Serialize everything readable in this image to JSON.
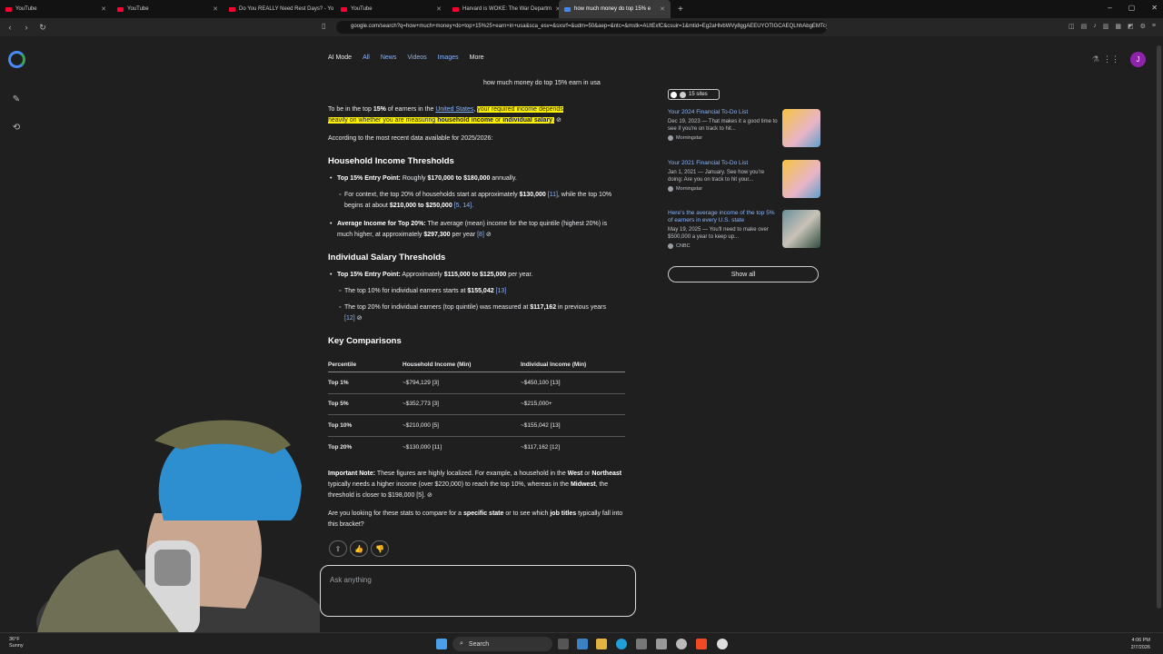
{
  "browser": {
    "tabs": [
      {
        "label": "YouTube",
        "active": false
      },
      {
        "label": "YouTube",
        "active": false
      },
      {
        "label": "Do You REALLY Need Rest Days? - Yo",
        "active": false
      },
      {
        "label": "YouTube",
        "active": false
      },
      {
        "label": "Harvard is WOKE: The War Departm",
        "active": false
      },
      {
        "label": "how much money do top 15% e",
        "active": true
      }
    ],
    "new_tab": "+",
    "url": "google.com/search?q=how+much+money+do+top+15%25+earn+in+usa&sca_esv=&sxsrf=&udm=50&aep=&ntc=&mstk=AUtExfC&csuir=1&mtid=Eg2aHlvbWVy8ggAEEUYOTIGCAEQLhhAbgEMTcyNzkgMGoxqg",
    "window_controls": [
      "–",
      "▢",
      "✕"
    ]
  },
  "search_tabs": [
    {
      "label": "AI Mode",
      "active": true
    },
    {
      "label": "All"
    },
    {
      "label": "News"
    },
    {
      "label": "Images"
    },
    {
      "label": "Videos"
    },
    {
      "label": "Images"
    },
    {
      "label": "More"
    }
  ],
  "search_tabs_display": [
    "AI Mode",
    "All",
    "News",
    "Videos",
    "Images",
    "More"
  ],
  "avatar_letter": "J",
  "query": "how much money do top 15% earn in usa",
  "answer": {
    "intro_pre": "To be in the top ",
    "intro_pct": "15%",
    "intro_mid": " of earners in the ",
    "intro_link": "United States",
    "intro_sep": ", ",
    "intro_hl1": "your required income depends",
    "intro_hl2": "heavily on whether you are measuring ",
    "intro_hl_b1": "household income",
    "intro_hl_or": " or ",
    "intro_hl_b2": "individual salary",
    "intro_end": ".",
    "data_note": "According to the most recent data available for 2025/2026:",
    "h_household": "Household Income Thresholds",
    "hh_entry_label": "Top 15% Entry Point:",
    "hh_entry_text_pre": " Roughly ",
    "hh_entry_range": "$170,000 to $180,000",
    "hh_entry_text_post": " annually.",
    "hh_context_pre": "For context, the top 20% of households start at approximately ",
    "hh_context_v1": "$130,000",
    "hh_context_c1": " [11]",
    "hh_context_mid": ", while the top 10% begins at about ",
    "hh_context_v2": "$210,000 to $250,000",
    "hh_context_c2": " [5, 14]",
    "hh_context_end": ".",
    "hh_avg_label": "Average Income for Top 20%:",
    "hh_avg_pre": " The average (mean) income for the top quintile (highest 20%) is much higher, at approximately ",
    "hh_avg_val": "$297,300",
    "hh_avg_post": " per year ",
    "hh_avg_cite": "[8]",
    "h_individual": "Individual Salary Thresholds",
    "ind_entry_label": "Top 15% Entry Point:",
    "ind_entry_pre": " Approximately ",
    "ind_entry_range": "$115,000 to $125,000",
    "ind_entry_post": " per year.",
    "ind_top10_pre": "The top 10% for individual earners starts at ",
    "ind_top10_val": "$155,042",
    "ind_top10_cite": " [13]",
    "ind_top20_pre": "The top 20% for individual earners (top quintile) was measured at ",
    "ind_top20_val": "$117,162",
    "ind_top20_post": " in previous years ",
    "ind_top20_cite": "[12]",
    "h_compare": "Key Comparisons",
    "table": {
      "headers": [
        "Percentile",
        "Household Income (Min)",
        "Individual Income (Min)"
      ],
      "rows": [
        [
          "Top 1%",
          "~$794,129 [3]",
          "~$450,100 [13]"
        ],
        [
          "Top 5%",
          "~$352,773 [3]",
          "~$215,000+"
        ],
        [
          "Top 10%",
          "~$210,000 [5]",
          "~$155,042 [13]"
        ],
        [
          "Top 20%",
          "~$130,000 [11]",
          "~$117,162 [12]"
        ]
      ]
    },
    "note_label": "Important Note:",
    "note_pre": " These figures are highly localized. For example, a household in the ",
    "note_west": "West",
    "note_or": " or ",
    "note_ne": "Northeast",
    "note_mid": " typically needs a higher income (over $220,000) to reach the top 10%, whereas in the ",
    "note_midwest": "Midwest",
    "note_end": ", the threshold is closer to $198,000 [5].",
    "followup_pre": "Are you looking for these stats to compare for a ",
    "followup_b1": "specific state",
    "followup_mid": " or to see which ",
    "followup_b2": "job titles",
    "followup_end": " typically fall into this bracket?"
  },
  "ask_placeholder": "Ask anything",
  "sources": {
    "badge": "15 sites",
    "cards": [
      {
        "title": "Your 2024 Financial To-Do List",
        "snippet": "Dec 19, 2023 — That makes it a good time to see if you're on track to hit...",
        "source": "Morningstar"
      },
      {
        "title": "Your 2021 Financial To-Do List",
        "snippet": "Jan 1, 2021 — January. See how you're doing: Are you on track to hit your...",
        "source": "Morningstar"
      },
      {
        "title": "Here's the average income of the top 5% of earners in every U.S. state",
        "snippet": "May 19, 2025 — You'll need to make over $500,000 a year to keep up...",
        "source": "CNBC"
      }
    ],
    "show_all": "Show all"
  },
  "taskbar": {
    "weather_temp": "36°F",
    "weather_desc": "Sunny",
    "search_label": "Search",
    "time": "4:06 PM",
    "date": "2/7/2026"
  }
}
